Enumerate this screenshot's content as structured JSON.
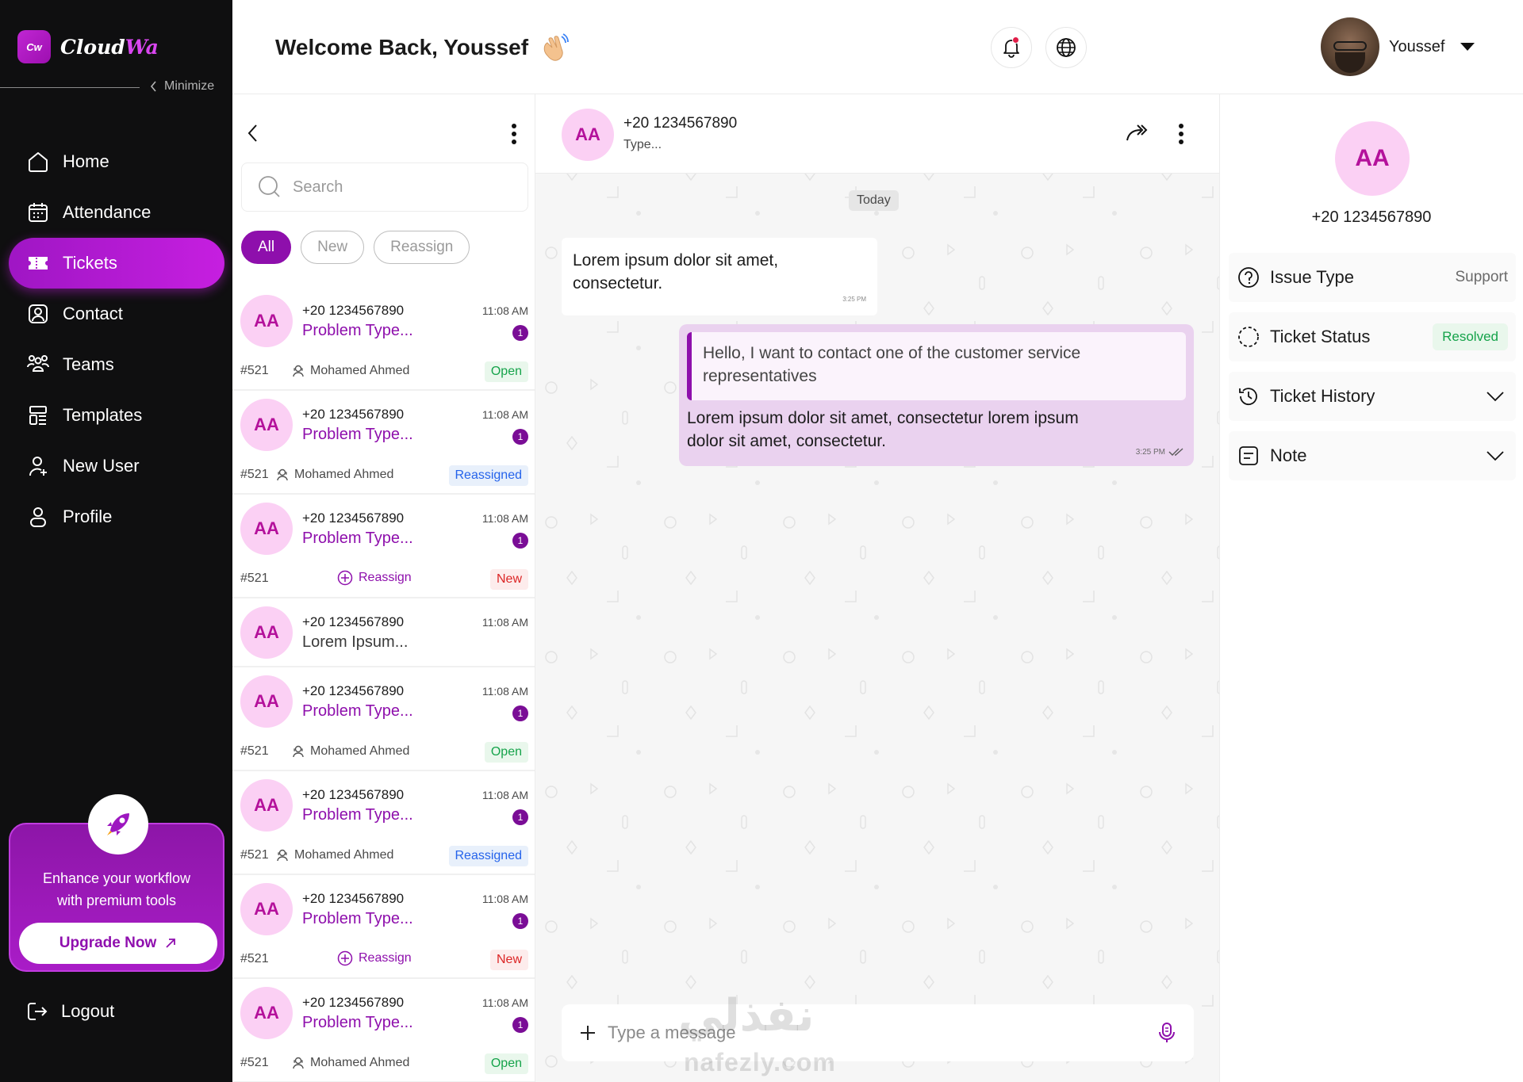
{
  "brand": {
    "logo_short": "Cw",
    "name_part1": "Cloud",
    "name_part2": "Wa"
  },
  "sidebar": {
    "minimize_label": "Minimize",
    "items": [
      {
        "label": "Home",
        "icon": "home-icon"
      },
      {
        "label": "Attendance",
        "icon": "calendar-icon"
      },
      {
        "label": "Tickets",
        "icon": "ticket-icon",
        "active": true
      },
      {
        "label": "Contact",
        "icon": "contact-icon"
      },
      {
        "label": "Teams",
        "icon": "teams-icon"
      },
      {
        "label": "Templates",
        "icon": "templates-icon"
      },
      {
        "label": "New User",
        "icon": "new-user-icon"
      },
      {
        "label": "Profile",
        "icon": "profile-icon"
      }
    ],
    "promo": {
      "line1": "Enhance your workflow",
      "line2": "with premium tools",
      "button": "Upgrade Now"
    },
    "logout": "Logout"
  },
  "header": {
    "welcome": "Welcome Back, Youssef",
    "user_name": "Youssef"
  },
  "list": {
    "search_placeholder": "Search",
    "filters": [
      "All",
      "New",
      "Reassign"
    ],
    "tickets": [
      {
        "initials": "AA",
        "phone": "+20 1234567890",
        "time": "11:08 AM",
        "subject": "Problem Type...",
        "count": "1",
        "id": "#521",
        "agent": "Mohamed Ahmed",
        "status": "Open",
        "kind": "agent"
      },
      {
        "initials": "AA",
        "phone": "+20 1234567890",
        "time": "11:08 AM",
        "subject": "Problem Type...",
        "count": "1",
        "id": "#521",
        "agent": "Mohamed Ahmed",
        "status": "Reassigned",
        "kind": "agent"
      },
      {
        "initials": "AA",
        "phone": "+20 1234567890",
        "time": "11:08 AM",
        "subject": "Problem Type...",
        "count": "1",
        "id": "#521",
        "agent": "Reassign",
        "status": "New",
        "kind": "reassign"
      },
      {
        "initials": "AA",
        "phone": "+20 1234567890",
        "time": "11:08 AM",
        "subject": "Lorem Ipsum...",
        "count": "",
        "id": "",
        "agent": "",
        "status": "",
        "kind": "short"
      },
      {
        "initials": "AA",
        "phone": "+20 1234567890",
        "time": "11:08 AM",
        "subject": "Problem Type...",
        "count": "1",
        "id": "#521",
        "agent": "Mohamed Ahmed",
        "status": "Open",
        "kind": "agent"
      },
      {
        "initials": "AA",
        "phone": "+20 1234567890",
        "time": "11:08 AM",
        "subject": "Problem Type...",
        "count": "1",
        "id": "#521",
        "agent": "Mohamed Ahmed",
        "status": "Reassigned",
        "kind": "agent"
      },
      {
        "initials": "AA",
        "phone": "+20 1234567890",
        "time": "11:08 AM",
        "subject": "Problem Type...",
        "count": "1",
        "id": "#521",
        "agent": "Reassign",
        "status": "New",
        "kind": "reassign"
      },
      {
        "initials": "AA",
        "phone": "+20 1234567890",
        "time": "11:08 AM",
        "subject": "Problem Type...",
        "count": "1",
        "id": "#521",
        "agent": "Mohamed Ahmed",
        "status": "Open",
        "kind": "agent"
      }
    ]
  },
  "chat": {
    "initials": "AA",
    "phone": "+20 1234567890",
    "status": "Type...",
    "date_divider": "Today",
    "incoming": {
      "text": "Lorem ipsum dolor sit amet, consectetur.",
      "time": "3:25 PM"
    },
    "outgoing": {
      "quote": "Hello, I want to contact one of the customer service representatives",
      "text": "Lorem ipsum dolor sit amet, consectetur lorem ipsum dolor sit amet, consectetur.",
      "time": "3:25 PM"
    },
    "composer_placeholder": "Type a message"
  },
  "details": {
    "initials": "AA",
    "phone": "+20 1234567890",
    "issue_type_label": "Issue Type",
    "issue_type_value": "Support",
    "ticket_status_label": "Ticket Status",
    "ticket_status_value": "Resolved",
    "ticket_history_label": "Ticket History",
    "note_label": "Note"
  },
  "watermark": {
    "arabic": "نفذلي",
    "latin": "nafezly.com"
  },
  "colors": {
    "brand": "#8e0fac",
    "avatar_bg": "#fbd0f4",
    "open": "#15a34a",
    "reassigned": "#2563eb",
    "new": "#dc2626"
  }
}
